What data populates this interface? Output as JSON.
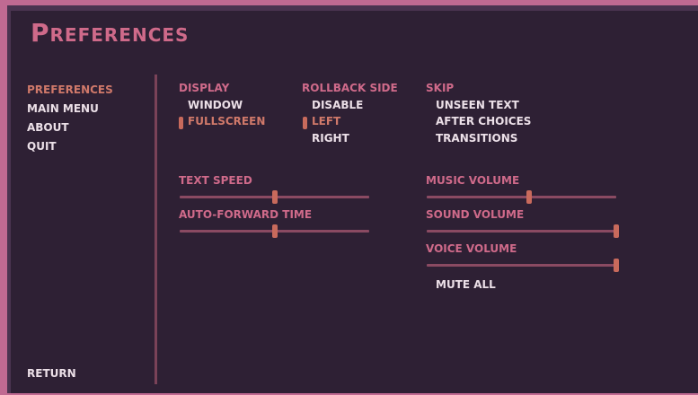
{
  "title": "Preferences",
  "nav": {
    "items": [
      "PREFERENCES",
      "MAIN MENU",
      "ABOUT",
      "QUIT"
    ],
    "active": "PREFERENCES",
    "return": "RETURN"
  },
  "display": {
    "heading": "DISPLAY",
    "options": [
      "WINDOW",
      "FULLSCREEN"
    ],
    "selected": "FULLSCREEN"
  },
  "rollback": {
    "heading": "ROLLBACK SIDE",
    "options": [
      "DISABLE",
      "LEFT",
      "RIGHT"
    ],
    "selected": "LEFT"
  },
  "skip": {
    "heading": "SKIP",
    "options": [
      "UNSEEN TEXT",
      "AFTER CHOICES",
      "TRANSITIONS"
    ]
  },
  "sliders": {
    "text_speed": {
      "label": "TEXT SPEED",
      "value": 0.5
    },
    "auto_forward": {
      "label": "AUTO-FORWARD TIME",
      "value": 0.5
    },
    "music_volume": {
      "label": "MUSIC VOLUME",
      "value": 0.54
    },
    "sound_volume": {
      "label": "SOUND VOLUME",
      "value": 1.0
    },
    "voice_volume": {
      "label": "VOICE VOLUME",
      "value": 1.0
    }
  },
  "mute_all": "MUTE ALL",
  "colors": {
    "accent": "#cf6a8a",
    "selected": "#d0796a",
    "text": "#ece0e8",
    "background": "#2c1f32"
  }
}
